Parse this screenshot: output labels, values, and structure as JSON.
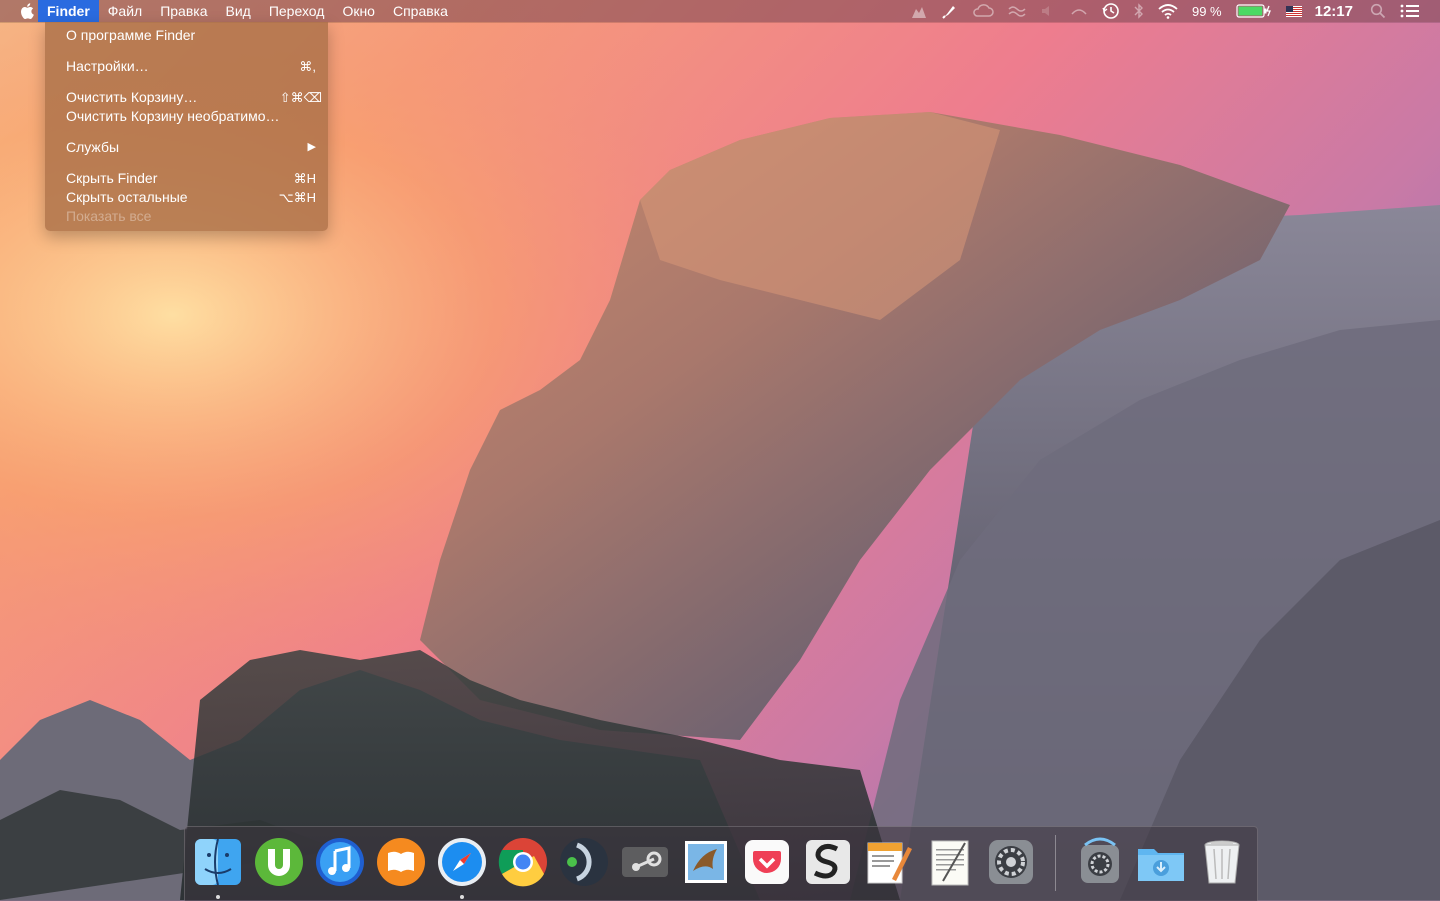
{
  "menubar": {
    "app_name": "Finder",
    "menus": [
      "Файл",
      "Правка",
      "Вид",
      "Переход",
      "Окно",
      "Справка"
    ],
    "battery_percent": "99 %",
    "clock": "12:17"
  },
  "finder_menu": {
    "items": [
      {
        "label": "О программе Finder",
        "shortcut": ""
      },
      {
        "label": "Настройки…",
        "shortcut": "⌘,"
      },
      {
        "label": "Очистить Корзину…",
        "shortcut": "⇧⌘⌫"
      },
      {
        "label": "Очистить Корзину необратимо…",
        "shortcut": ""
      },
      {
        "label": "Службы",
        "shortcut": "▶"
      },
      {
        "label": "Скрыть Finder",
        "shortcut": "⌘H"
      },
      {
        "label": "Скрыть остальные",
        "shortcut": "⌥⌘H"
      },
      {
        "label": "Показать все",
        "shortcut": ""
      }
    ]
  },
  "dock": {
    "apps": [
      "finder-icon",
      "utorrent-icon",
      "itunes-icon",
      "ibooks-icon",
      "safari-icon",
      "chrome-icon",
      "teamspeak-icon",
      "steam-icon",
      "mail-icon",
      "pocket-icon",
      "scrivener-icon",
      "pages-icon",
      "textedit-icon",
      "system-preferences-icon"
    ],
    "stacks": [
      "applications-stack-icon",
      "downloads-folder-icon",
      "trash-icon"
    ]
  },
  "colors": {
    "menu_highlight": "#2a6be0",
    "battery_fill": "#4cd964"
  }
}
